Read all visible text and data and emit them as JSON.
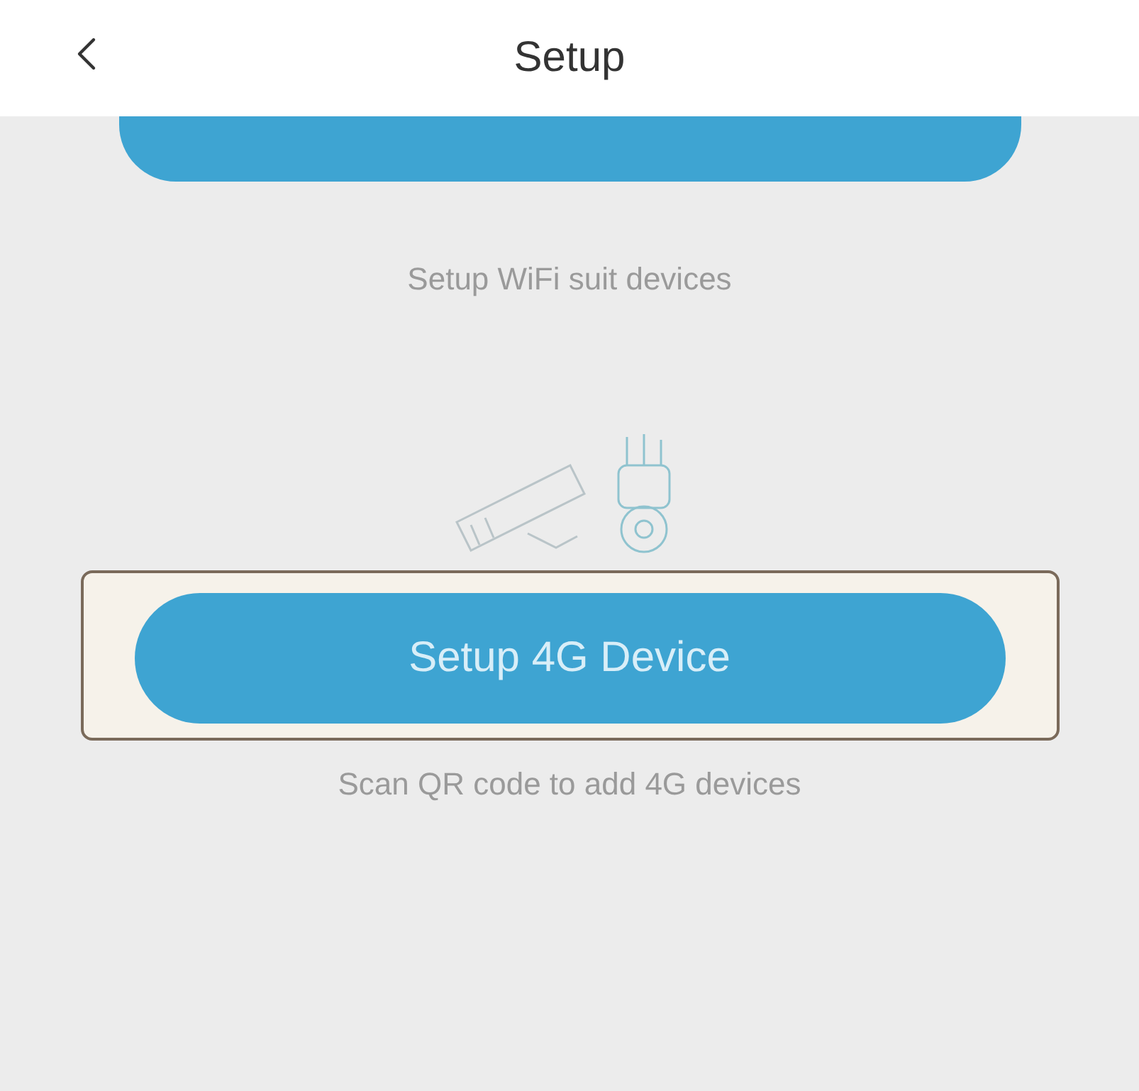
{
  "header": {
    "title": "Setup"
  },
  "wifi_section": {
    "description": "Setup WiFi suit devices"
  },
  "fourg_section": {
    "button": "Setup 4G Device",
    "highlighted": true,
    "description": "Scan QR code to add 4G devices"
  }
}
